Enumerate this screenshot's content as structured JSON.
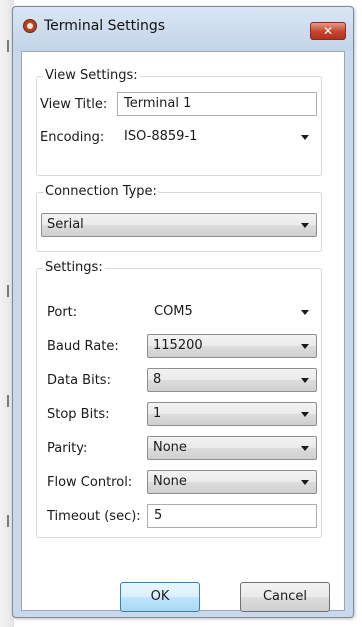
{
  "window": {
    "title": "Terminal Settings",
    "close_glyph": "✕",
    "icon": "app-logo-icon"
  },
  "view_settings": {
    "legend": "View Settings:",
    "view_title_label": "View Title:",
    "view_title_value": "Terminal 1",
    "encoding_label": "Encoding:",
    "encoding_value": "ISO-8859-1"
  },
  "connection_type": {
    "legend": "Connection Type:",
    "value": "Serial"
  },
  "settings": {
    "legend": "Settings:",
    "port_label": "Port:",
    "port_value": "COM5",
    "baud_label": "Baud Rate:",
    "baud_value": "115200",
    "data_bits_label": "Data Bits:",
    "data_bits_value": "8",
    "stop_bits_label": "Stop Bits:",
    "stop_bits_value": "1",
    "parity_label": "Parity:",
    "parity_value": "None",
    "flow_label": "Flow Control:",
    "flow_value": "None",
    "timeout_label": "Timeout (sec):",
    "timeout_value": "5"
  },
  "buttons": {
    "ok": "OK",
    "cancel": "Cancel"
  },
  "colors": {
    "window_frame": "#c9d8ea",
    "close_button": "#c4442c",
    "ok_button_border": "#3c7fb1"
  }
}
